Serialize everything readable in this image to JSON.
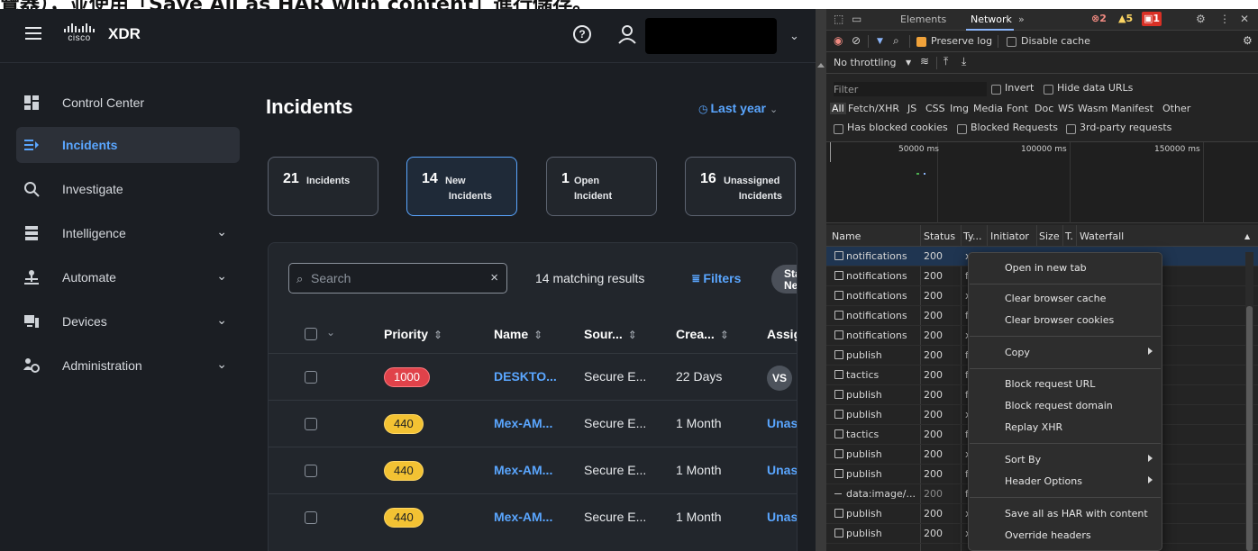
{
  "caption": {
    "text": "覽器），並使用「Save All as HAR with content」進行儲存。"
  },
  "app": {
    "title": "XDR",
    "brand": "cisco",
    "help_glyph": "?",
    "acct_chevron": "⌄",
    "sidebar": {
      "items": [
        {
          "label": "Control Center",
          "icon": "control-center-icon"
        },
        {
          "label": "Incidents",
          "icon": "incidents-icon",
          "active": true
        },
        {
          "label": "Investigate",
          "icon": "search-icon"
        },
        {
          "label": "Intelligence",
          "icon": "intelligence-icon",
          "expandable": true
        },
        {
          "label": "Automate",
          "icon": "automate-icon",
          "expandable": true
        },
        {
          "label": "Devices",
          "icon": "devices-icon",
          "expandable": true
        },
        {
          "label": "Administration",
          "icon": "administration-icon",
          "expandable": true
        }
      ],
      "chevron": "⌄"
    },
    "page_title": "Incidents",
    "time_range": {
      "label": "Last year",
      "clock": "◷",
      "caret": "⌄"
    },
    "summary_cards": [
      {
        "count": "21",
        "label": "Incidents"
      },
      {
        "count": "14",
        "label_line1": "New",
        "label_line2": "Incidents",
        "selected": true
      },
      {
        "count": "1",
        "label_line1": "Open",
        "label_line2": "Incident"
      },
      {
        "count": "16",
        "label_line1": "Unassigned",
        "label_line2": "Incidents"
      }
    ],
    "table_panel": {
      "search_placeholder": "Search",
      "search_glyph": "⌕",
      "clear_glyph": "×",
      "matching": "14 matching results",
      "filters_label": "Filters",
      "filters_glyph": "⩸",
      "status_pill_line1": "Stat",
      "status_pill_line2": "New",
      "head_chevron": "⌄",
      "sort_glyph": "⇕",
      "columns": [
        "Priority",
        "Name",
        "Sour...",
        "Crea...",
        "Assign"
      ],
      "rows": [
        {
          "priority": "1000",
          "priority_color": "red",
          "name": "DESKTO...",
          "source": "Secure E...",
          "created": "22 Days",
          "assignee": "VS",
          "assignee_type": "avatar"
        },
        {
          "priority": "440",
          "priority_color": "yellow",
          "name": "Mex-AM...",
          "source": "Secure E...",
          "created": "1 Month",
          "assignee": "Unassi",
          "assignee_type": "link"
        },
        {
          "priority": "440",
          "priority_color": "yellow",
          "name": "Mex-AM...",
          "source": "Secure E...",
          "created": "1 Month",
          "assignee": "Unassi",
          "assignee_type": "link"
        },
        {
          "priority": "440",
          "priority_color": "yellow",
          "name": "Mex-AM...",
          "source": "Secure E...",
          "created": "1 Month",
          "assignee": "Unassi",
          "assignee_type": "link"
        }
      ]
    },
    "colors": {
      "accent": "#5aa6ff",
      "bg": "#1b1e23",
      "priority_red": "#e0424a",
      "priority_yellow": "#f3c233"
    }
  },
  "devtools": {
    "tabs": [
      "Elements",
      "Network"
    ],
    "active_tab": "Network",
    "more_tabs": "»",
    "errors": "2",
    "warnings": "5",
    "issues": "1",
    "glyphs": {
      "error": "⊗",
      "warning": "▲",
      "issue": "▣",
      "gear": "⚙",
      "menu": "⋮",
      "close": "✕",
      "inspect": "⬚",
      "device": "▭",
      "record": "◉",
      "clear": "⊘",
      "filter": "▼",
      "search": "⌕",
      "wifi": "≋",
      "upload": "⤒",
      "download": "⤓",
      "caret": "▼"
    },
    "toolbar": {
      "preserve_log": "Preserve log",
      "disable_cache": "Disable cache",
      "throttling": "No throttling"
    },
    "filter": {
      "placeholder": "Filter",
      "invert": "Invert",
      "hide_data_urls": "Hide data URLs",
      "types": [
        "All",
        "Fetch/XHR",
        "JS",
        "CSS",
        "Img",
        "Media",
        "Font",
        "Doc",
        "WS",
        "Wasm",
        "Manifest",
        "Other"
      ],
      "has_blocked_cookies": "Has blocked cookies",
      "blocked_requests": "Blocked Requests",
      "third_party": "3rd-party requests"
    },
    "timeline_ticks": [
      "50000 ms",
      "100000 ms",
      "150000 ms"
    ],
    "columns": [
      "Name",
      "Status",
      "Ty...",
      "Initiator",
      "Size",
      "T.",
      "Waterfall"
    ],
    "requests": [
      {
        "name": "notifications",
        "status": "200",
        "type": "x"
      },
      {
        "name": "notifications",
        "status": "200",
        "type": "f"
      },
      {
        "name": "notifications",
        "status": "200",
        "type": "x"
      },
      {
        "name": "notifications",
        "status": "200",
        "type": "f"
      },
      {
        "name": "notifications",
        "status": "200",
        "type": "x"
      },
      {
        "name": "publish",
        "status": "200",
        "type": "f"
      },
      {
        "name": "tactics",
        "status": "200",
        "type": "f"
      },
      {
        "name": "publish",
        "status": "200",
        "type": "f"
      },
      {
        "name": "publish",
        "status": "200",
        "type": "x"
      },
      {
        "name": "tactics",
        "status": "200",
        "type": "f"
      },
      {
        "name": "publish",
        "status": "200",
        "type": "x"
      },
      {
        "name": "publish",
        "status": "200",
        "type": "f"
      },
      {
        "name": "data:image/...",
        "status": "200",
        "type": "f"
      },
      {
        "name": "publish",
        "status": "200",
        "type": "x"
      },
      {
        "name": "publish",
        "status": "200",
        "type": "x"
      }
    ],
    "context_menu": {
      "groups": [
        [
          "Open in new tab"
        ],
        [
          "Clear browser cache",
          "Clear browser cookies"
        ],
        [
          "Copy"
        ],
        [
          "Block request URL",
          "Block request domain",
          "Replay XHR"
        ],
        [
          "Sort By",
          "Header Options"
        ],
        [
          "Save all as HAR with content",
          "Override headers"
        ]
      ],
      "submenus": [
        "Copy",
        "Sort By",
        "Header Options"
      ]
    }
  }
}
